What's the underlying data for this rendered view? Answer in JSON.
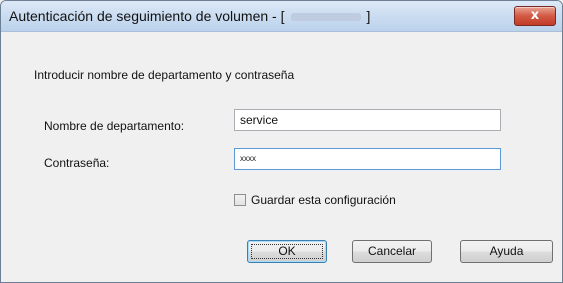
{
  "window": {
    "title_prefix": "Autenticación de seguimiento de volumen - [",
    "title_suffix": "]",
    "close_glyph": "x"
  },
  "dialog": {
    "instruction": "Introducir nombre de departamento y contraseña",
    "department_label": "Nombre de departamento:",
    "department_value": "service",
    "password_label": "Contraseña:",
    "password_value": "xxxx",
    "save_checkbox_label": "Guardar esta configuración",
    "save_checked": false
  },
  "buttons": {
    "ok": "OK",
    "cancel": "Cancelar",
    "help": "Ayuda"
  },
  "colors": {
    "titlebar": "#c9dbf0",
    "close_button": "#d25a44",
    "focus_border": "#5b9bd5"
  }
}
